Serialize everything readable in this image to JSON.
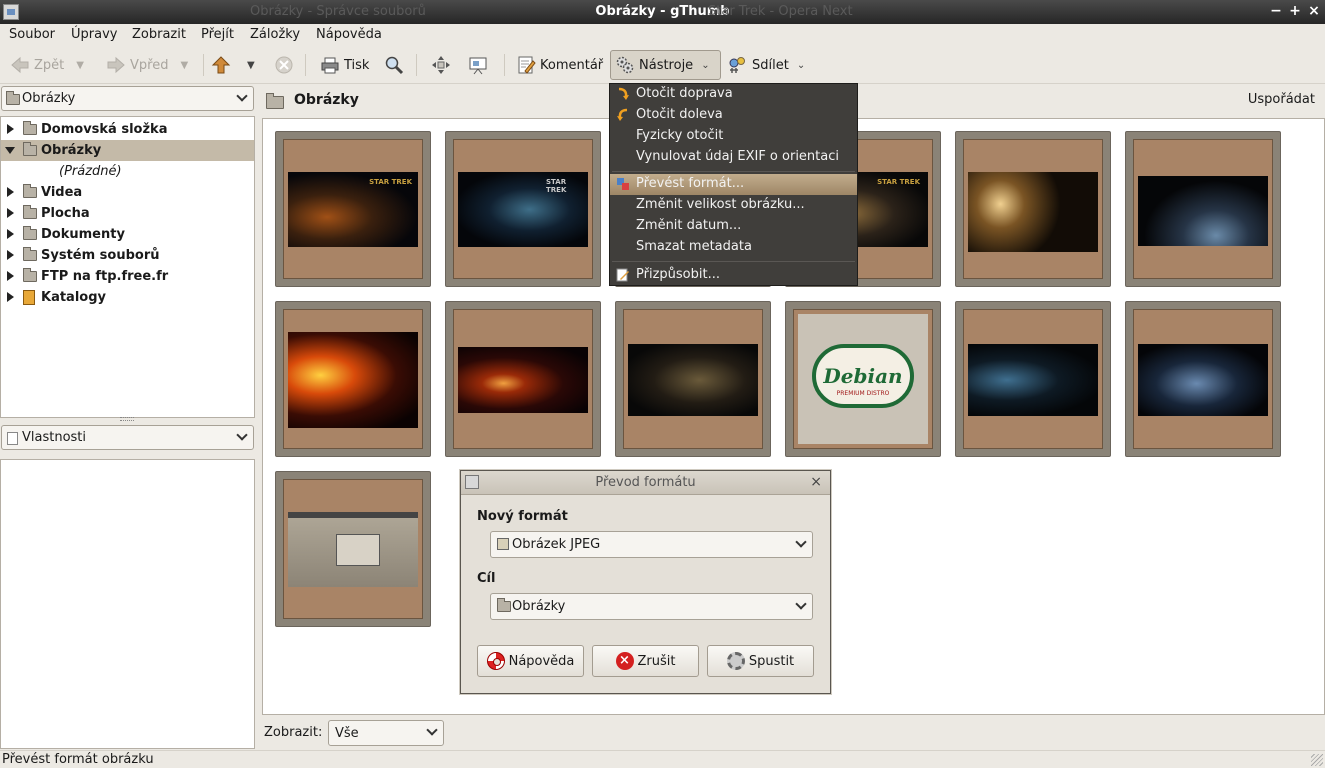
{
  "window": {
    "title": "Obrázky - gThumb",
    "ghost_title_left": "Obrázky - Správce souborů",
    "ghost_title_right": "Star Trek - Opera Next",
    "minimize": "−",
    "maximize": "+",
    "close": "×"
  },
  "menubar": {
    "items": [
      "Soubor",
      "Úpravy",
      "Zobrazit",
      "Přejít",
      "Záložky",
      "Nápověda"
    ]
  },
  "toolbar": {
    "back": "Zpět",
    "forward": "Vpřed",
    "print": "Tisk",
    "comment": "Komentář",
    "tools": "Nástroje",
    "share": "Sdílet"
  },
  "sidebar": {
    "location": "Obrázky",
    "tree": [
      {
        "label": "Domovská složka",
        "expanded": false,
        "selected": false
      },
      {
        "label": "Obrázky",
        "expanded": true,
        "selected": true
      },
      {
        "label": "(Prázdné)",
        "child": true
      },
      {
        "label": "Videa",
        "expanded": false,
        "selected": false
      },
      {
        "label": "Plocha",
        "expanded": false,
        "selected": false
      },
      {
        "label": "Dokumenty",
        "expanded": false,
        "selected": false
      },
      {
        "label": "Systém souborů",
        "expanded": false,
        "selected": false
      },
      {
        "label": "FTP na ftp.free.fr",
        "expanded": false,
        "selected": false
      },
      {
        "label": "Katalogy",
        "expanded": false,
        "selected": false
      }
    ],
    "properties_label": "Vlastnosti"
  },
  "main": {
    "location_title": "Obrázky",
    "sort_label": "Uspořádat",
    "thumb_texts": {
      "startrek": "STAR TREK",
      "debian": "Debian",
      "debian_sub": "PREMIUM DISTRO"
    }
  },
  "tools_menu": {
    "items": [
      {
        "label": "Otočit doprava",
        "icon": "rotate-right-icon"
      },
      {
        "label": "Otočit doleva",
        "icon": "rotate-left-icon"
      },
      {
        "label": "Fyzicky otočit",
        "icon": ""
      },
      {
        "label": "Vynulovat údaj EXIF o orientaci",
        "icon": ""
      },
      {
        "label": "Převést formát...",
        "icon": "convert-format-icon",
        "highlighted": true
      },
      {
        "label": "Změnit velikost obrázku...",
        "icon": ""
      },
      {
        "label": "Změnit datum...",
        "icon": ""
      },
      {
        "label": "Smazat metadata",
        "icon": ""
      },
      {
        "label": "Přizpůsobit...",
        "icon": "customize-icon"
      }
    ]
  },
  "dialog": {
    "title": "Převod formátu",
    "close": "×",
    "new_format_label": "Nový formát",
    "new_format_value": "Obrázek JPEG",
    "target_label": "Cíl",
    "target_value": "Obrázky",
    "help_button": "Nápověda",
    "cancel_button": "Zrušit",
    "run_button": "Spustit"
  },
  "filter": {
    "label": "Zobrazit:",
    "value": "Vše"
  },
  "statusbar": {
    "text": "Převést formát obrázku"
  }
}
